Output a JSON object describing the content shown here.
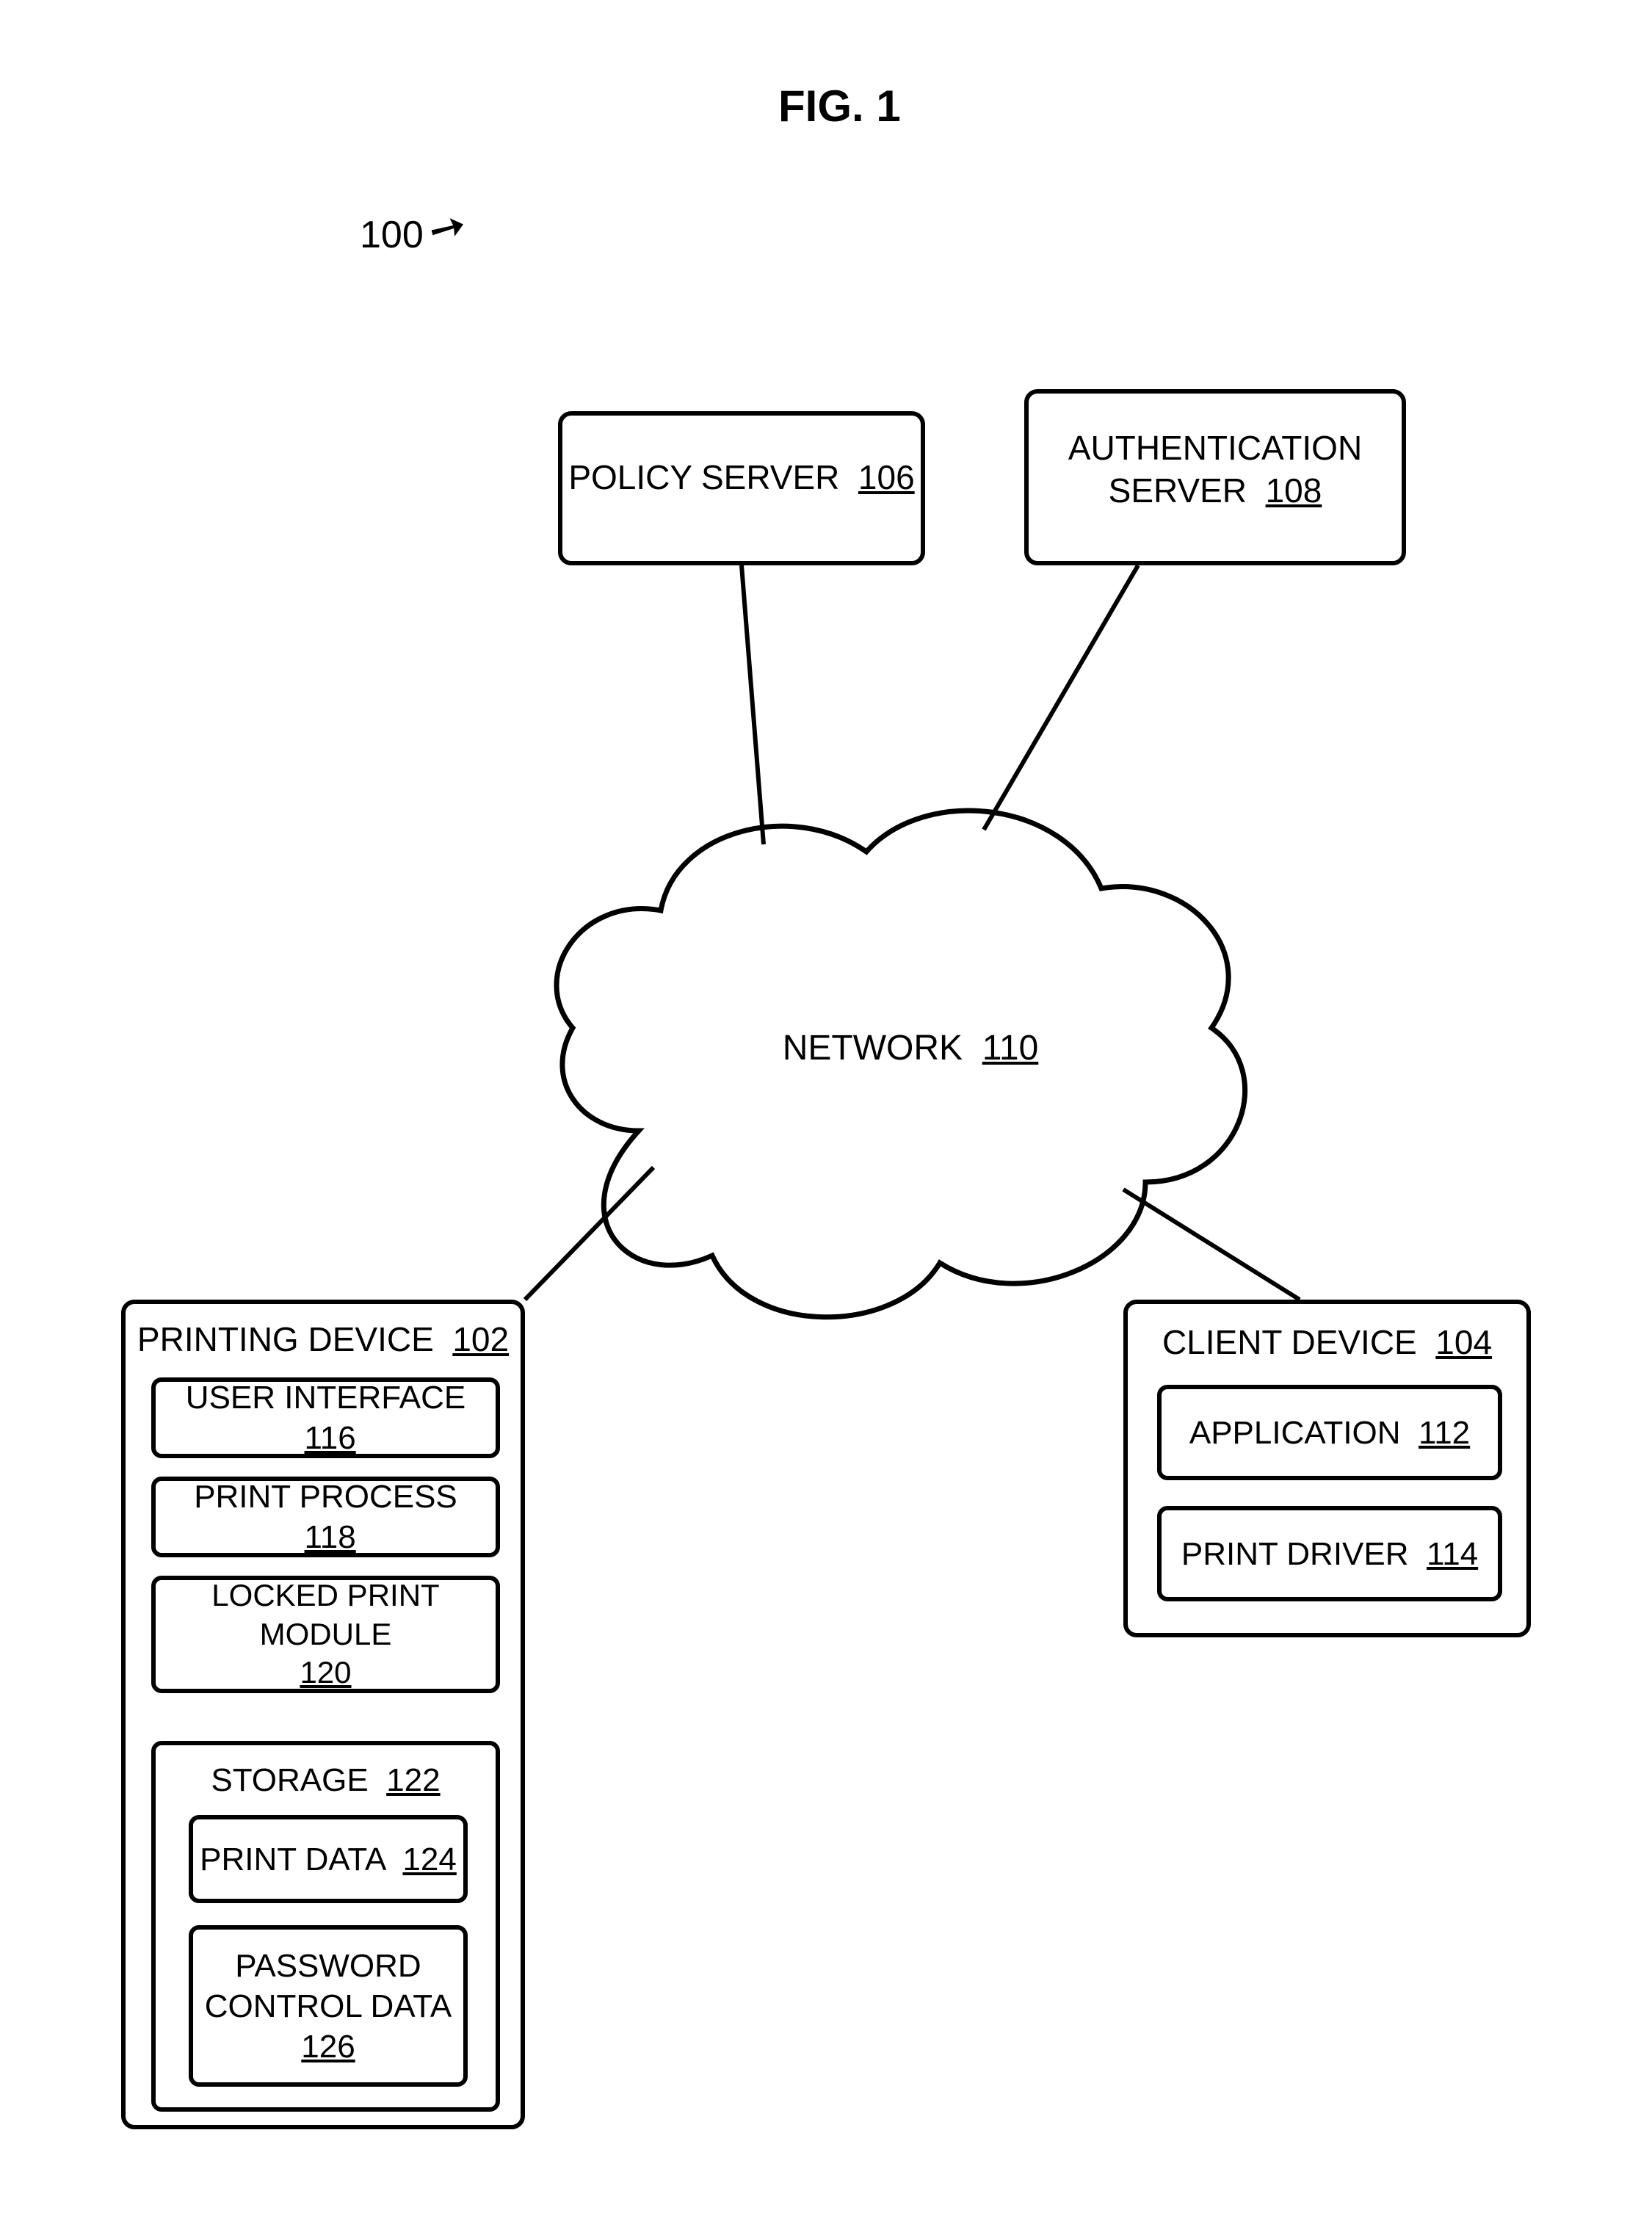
{
  "figure": {
    "title": "FIG. 1",
    "ref": "100"
  },
  "network": {
    "label": "NETWORK",
    "num": "110"
  },
  "policy_server": {
    "label": "POLICY SERVER",
    "num": "106"
  },
  "auth_server": {
    "label_line1": "AUTHENTICATION",
    "label_line2": "SERVER",
    "num": "108"
  },
  "client_device": {
    "label": "CLIENT DEVICE",
    "num": "104",
    "application": {
      "label": "APPLICATION",
      "num": "112"
    },
    "print_driver": {
      "label": "PRINT DRIVER",
      "num": "114"
    }
  },
  "printing_device": {
    "label": "PRINTING DEVICE",
    "num": "102",
    "user_interface": {
      "label": "USER INTERFACE",
      "num": "116"
    },
    "print_process": {
      "label": "PRINT PROCESS",
      "num": "118"
    },
    "locked_print_module": {
      "label": "LOCKED PRINT MODULE",
      "num": "120"
    },
    "storage": {
      "label": "STORAGE",
      "num": "122",
      "print_data": {
        "label": "PRINT DATA",
        "num": "124"
      },
      "password_control_data": {
        "label_line1": "PASSWORD",
        "label_line2": "CONTROL DATA",
        "num": "126"
      }
    }
  }
}
